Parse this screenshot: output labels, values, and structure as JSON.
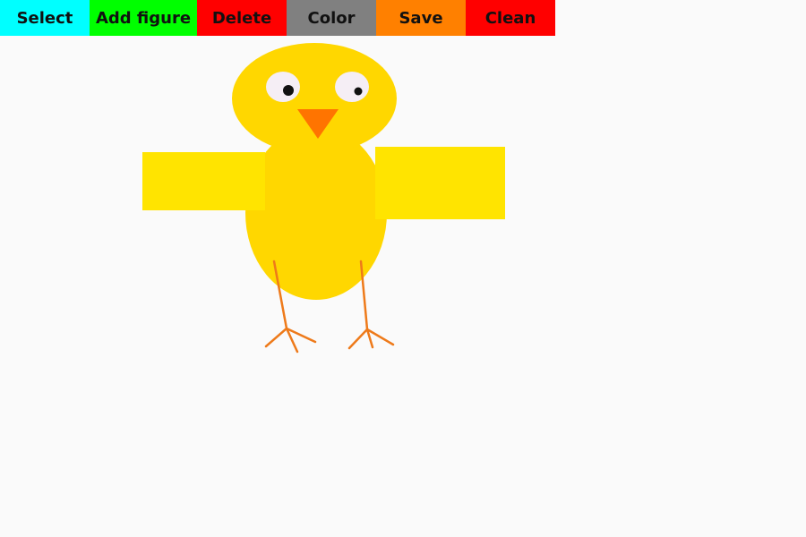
{
  "toolbar": {
    "buttons": [
      {
        "id": "select",
        "label": "Select",
        "color": "#00ffff"
      },
      {
        "id": "add-figure",
        "label": "Add figure",
        "color": "#00ff00"
      },
      {
        "id": "delete",
        "label": "Delete",
        "color": "#ff0000"
      },
      {
        "id": "color",
        "label": "Color",
        "color": "#808080"
      },
      {
        "id": "save",
        "label": "Save",
        "color": "#ff8000"
      },
      {
        "id": "clean",
        "label": "Clean",
        "color": "#ff0000"
      }
    ]
  },
  "canvas": {
    "background": "#fafafa",
    "figures": [
      {
        "name": "chick-head",
        "shape": "ellipse",
        "color": "#ffd700"
      },
      {
        "name": "chick-body",
        "shape": "ellipse",
        "color": "#ffd700"
      },
      {
        "name": "left-wing",
        "shape": "rectangle",
        "color": "#ffe400"
      },
      {
        "name": "right-wing",
        "shape": "rectangle",
        "color": "#ffe400"
      },
      {
        "name": "left-eye",
        "shape": "ellipse",
        "color": "#f5eef5"
      },
      {
        "name": "right-eye",
        "shape": "ellipse",
        "color": "#f5eef5"
      },
      {
        "name": "left-pupil",
        "shape": "circle",
        "color": "#111111"
      },
      {
        "name": "right-pupil",
        "shape": "circle",
        "color": "#111111"
      },
      {
        "name": "beak",
        "shape": "triangle",
        "color": "#ff7400"
      },
      {
        "name": "left-leg",
        "shape": "lines",
        "color": "#ee7a1a"
      },
      {
        "name": "right-leg",
        "shape": "lines",
        "color": "#ee7a1a"
      }
    ]
  }
}
